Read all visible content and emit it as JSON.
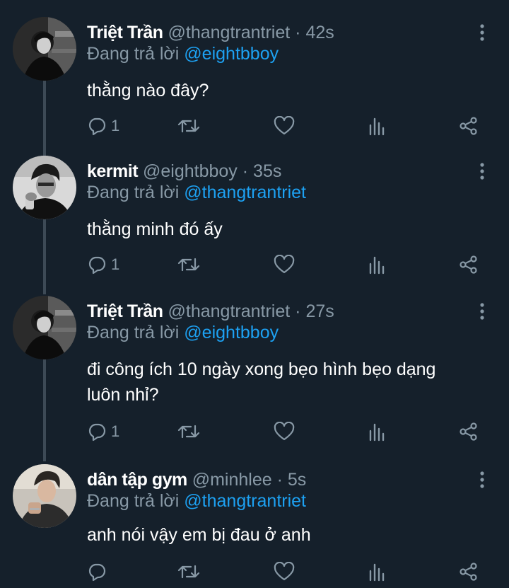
{
  "colors": {
    "background": "#15202b",
    "secondary_text": "#8899a6",
    "link": "#1da1f2",
    "thread_line": "#3d4a56"
  },
  "reply_prefix": "Đang trả lời",
  "tweets": [
    {
      "name": "Triệt Trần",
      "handle": "@thangtrantriet",
      "time": "42s",
      "reply_to": "@eightbboy",
      "text": "thằng nào đây?",
      "reply_count": "1",
      "avatar": "avatar-dark-portrait"
    },
    {
      "name": "kermit",
      "handle": "@eightbboy",
      "time": "35s",
      "reply_to": "@thangtrantriet",
      "text": "thằng minh đó ấy",
      "reply_count": "1",
      "avatar": "avatar-bw-portrait"
    },
    {
      "name": "Triệt Trần",
      "handle": "@thangtrantriet",
      "time": "27s",
      "reply_to": "@eightbboy",
      "text": "đi công ích 10 ngày xong bẹo hình bẹo dạng luôn nhỉ?",
      "reply_count": "1",
      "avatar": "avatar-dark-portrait"
    },
    {
      "name": "dân tập gym",
      "handle": "@minhlee",
      "time": "5s",
      "reply_to": "@thangtrantriet",
      "text": "anh nói vậy em bị đau ở anh",
      "reply_count": "",
      "avatar": "avatar-color-portrait"
    }
  ],
  "icons": [
    "reply-icon",
    "retweet-icon",
    "like-icon",
    "analytics-icon",
    "share-icon",
    "more-icon"
  ]
}
